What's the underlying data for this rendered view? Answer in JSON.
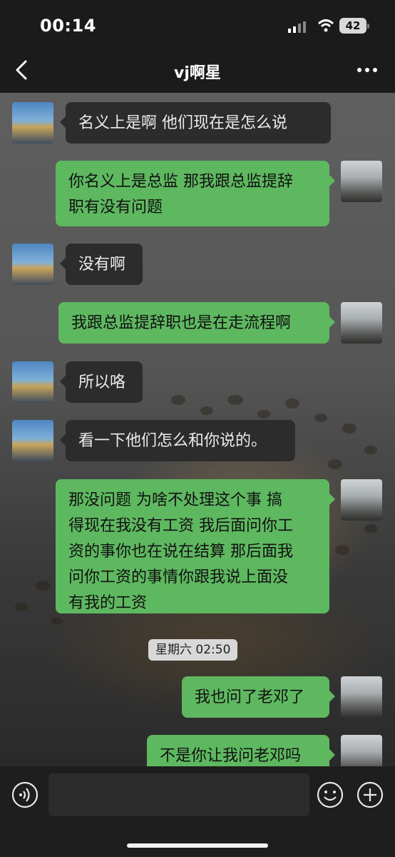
{
  "status_bar": {
    "time": "00:14",
    "battery": "42"
  },
  "nav": {
    "title": "vj啊星",
    "back_icon": "chevron-left-icon",
    "more_icon": "more-dots-icon"
  },
  "messages": [
    {
      "side": "in",
      "text": "名义上是啊   他们现在是怎么说"
    },
    {
      "side": "out",
      "lines": [
        "你名义上是总监 那我跟总监提辞",
        "职有没有问题"
      ]
    },
    {
      "side": "in",
      "text": "没有啊"
    },
    {
      "side": "out",
      "text": "我跟总监提辞职也是在走流程啊"
    },
    {
      "side": "in",
      "text": "所以咯"
    },
    {
      "side": "in",
      "text": "看一下他们怎么和你说的。"
    },
    {
      "side": "out",
      "lines": [
        "那没问题 为啥不处理这个事 搞",
        "得现在我没有工资 我后面问你工",
        "资的事你也在说在结算 那后面我",
        "问你工资的事情你跟我说上面没",
        "有我的工资"
      ]
    },
    {
      "side": "out",
      "text": "我也问了老邓了"
    },
    {
      "side": "out",
      "text": "不是你让我问老邓吗"
    }
  ],
  "time_separator": "星期六 02:50",
  "input_bar": {
    "voice_icon": "voice-icon",
    "emoji_icon": "emoji-icon",
    "add_icon": "plus-circle-icon"
  },
  "colors": {
    "outgoing_bubble": "#5eb860",
    "incoming_bubble": "#2c2c2c",
    "bar_background": "#1b1b1b"
  }
}
